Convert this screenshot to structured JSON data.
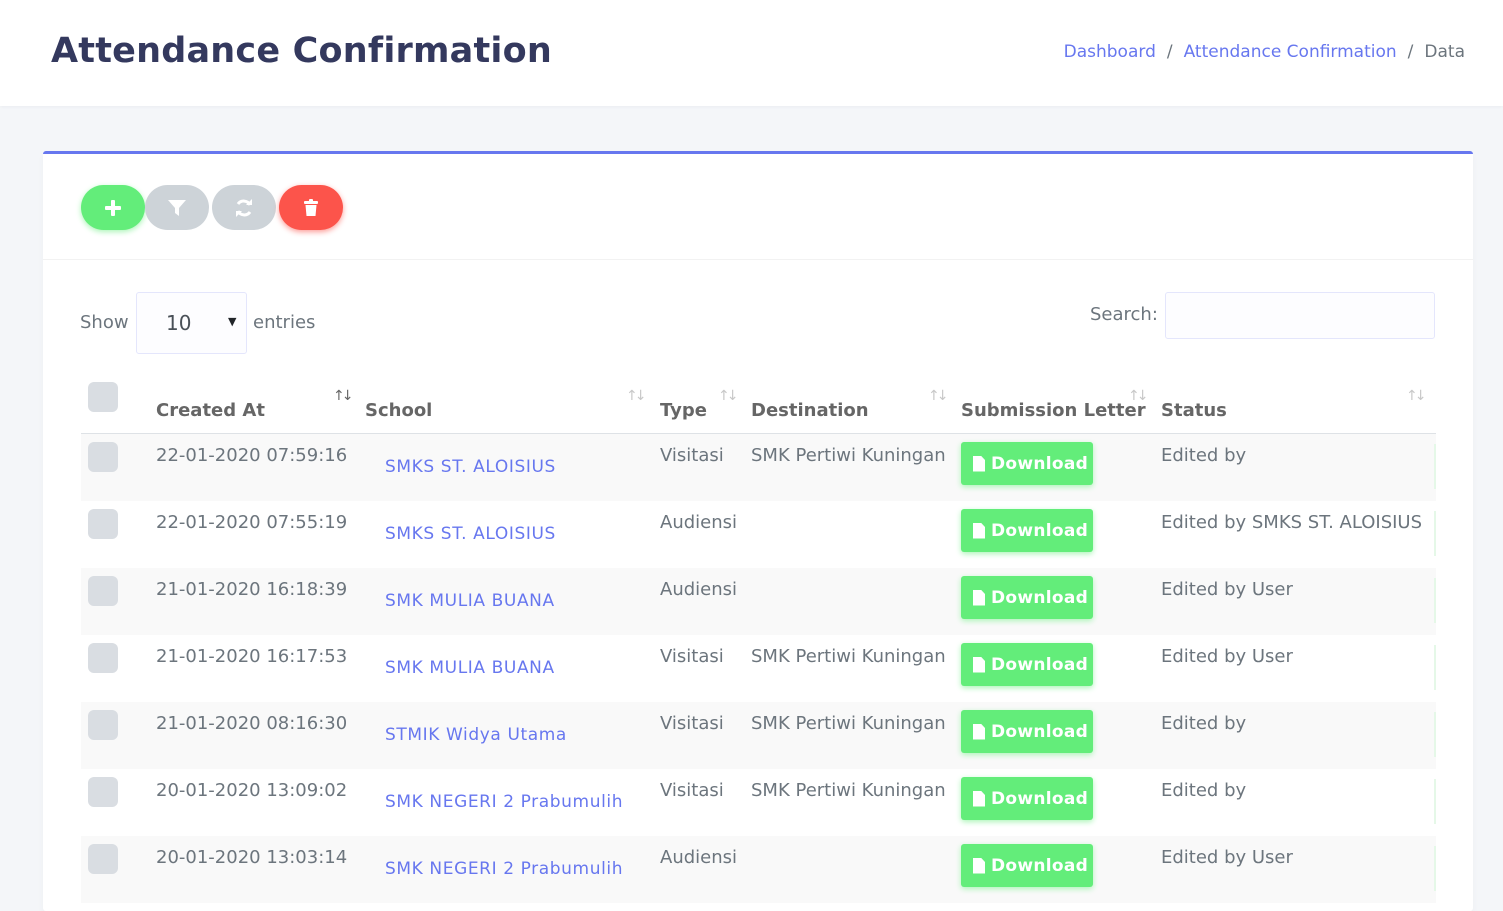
{
  "header": {
    "title": "Attendance Confirmation",
    "breadcrumb": [
      "Dashboard",
      "Attendance Confirmation",
      "Data"
    ]
  },
  "toolbar": {
    "buttons": [
      {
        "name": "add",
        "icon": "plus-icon",
        "color": "#63ed7a"
      },
      {
        "name": "filter",
        "icon": "filter-icon",
        "color": "#cdd3d8"
      },
      {
        "name": "refresh",
        "icon": "refresh-icon",
        "color": "#cdd3d8"
      },
      {
        "name": "delete",
        "icon": "trash-icon",
        "color": "#fc544b"
      }
    ]
  },
  "controls": {
    "show_label": "Show",
    "entries_value": "10",
    "entries_label": "entries",
    "search_label": "Search:",
    "search_value": ""
  },
  "table": {
    "columns": [
      "Created At",
      "School",
      "Type",
      "Destination",
      "Submission Letter",
      "Status"
    ],
    "download_label": "Download",
    "rows": [
      {
        "created_at": "22-01-2020 07:59:16",
        "school": "SMKS ST. ALOISIUS",
        "type": "Visitasi",
        "destination": "SMK Pertiwi Kuningan",
        "status": "Edited by"
      },
      {
        "created_at": "22-01-2020 07:55:19",
        "school": "SMKS ST. ALOISIUS",
        "type": "Audiensi",
        "destination": "",
        "status": "Edited by SMKS ST. ALOISIUS"
      },
      {
        "created_at": "21-01-2020 16:18:39",
        "school": "SMK MULIA BUANA",
        "type": "Audiensi",
        "destination": "",
        "status": "Edited by User"
      },
      {
        "created_at": "21-01-2020 16:17:53",
        "school": "SMK MULIA BUANA",
        "type": "Visitasi",
        "destination": "SMK Pertiwi Kuningan",
        "status": "Edited by User"
      },
      {
        "created_at": "21-01-2020 08:16:30",
        "school": "STMIK Widya Utama",
        "type": "Visitasi",
        "destination": "SMK Pertiwi Kuningan",
        "status": "Edited by"
      },
      {
        "created_at": "20-01-2020 13:09:02",
        "school": "SMK NEGERI 2 Prabumulih",
        "type": "Visitasi",
        "destination": "SMK Pertiwi Kuningan",
        "status": "Edited by"
      },
      {
        "created_at": "20-01-2020 13:03:14",
        "school": "SMK NEGERI 2 Prabumulih",
        "type": "Audiensi",
        "destination": "",
        "status": "Edited by User"
      }
    ]
  },
  "colors": {
    "primary": "#6777ef",
    "success": "#63ed7a",
    "danger": "#fc544b",
    "muted": "#cdd3d8"
  }
}
